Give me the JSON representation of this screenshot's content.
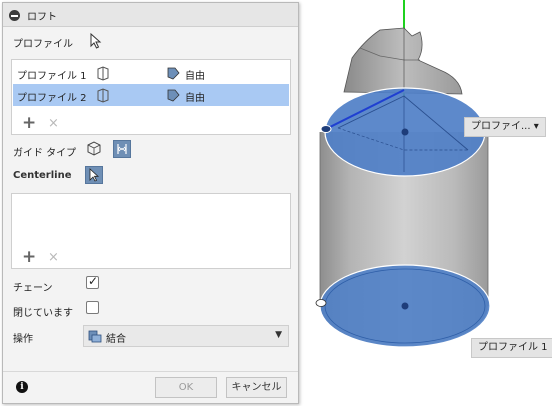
{
  "dialog": {
    "title": "ロフト",
    "profile_label": "プロファイル",
    "profiles": [
      {
        "name": "プロファイル 1",
        "condition": "自由",
        "selected": false
      },
      {
        "name": "プロファイル 2",
        "condition": "自由",
        "selected": true
      }
    ],
    "guide_type_label": "ガイド タイプ",
    "centerline_label": "Centerline",
    "chain_label": "チェーン",
    "chain_checked": true,
    "closed_label": "閉じています",
    "closed_checked": false,
    "operation_label": "操作",
    "operation_value": "結合",
    "ok_label": "OK",
    "cancel_label": "キャンセル",
    "add_symbol": "+",
    "remove_symbol": "×",
    "info_symbol": "i"
  },
  "viewport": {
    "tag_top": "プロファイ...",
    "tag_top_caret": "▾",
    "tag_bottom": "プロファイル 1",
    "colors": {
      "profile_fill": "#4f7fc7",
      "body_gray": "#bdbdbd",
      "axis_green": "#1fd11f",
      "guide_blue": "#1f3fd1"
    }
  }
}
